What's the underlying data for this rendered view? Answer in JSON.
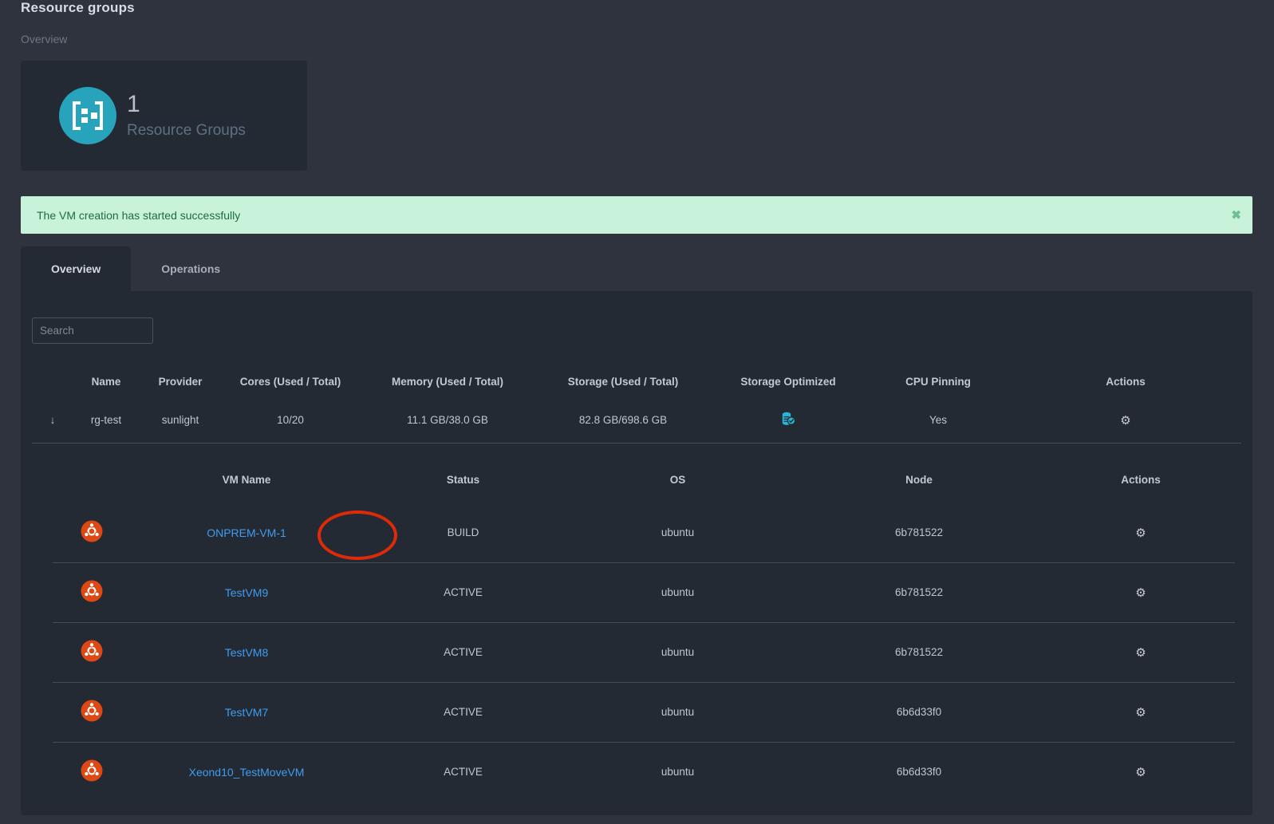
{
  "page": {
    "title": "Resource groups",
    "breadcrumb": "Overview"
  },
  "stat_card": {
    "icon": "resource-group-icon",
    "value": "1",
    "label": "Resource Groups",
    "icon_color": "#27a3bc"
  },
  "alert": {
    "message": "The VM creation has started successfully",
    "close_label": "✖",
    "background": "#c8f2da",
    "text_color": "#1f6b44"
  },
  "tabs": [
    {
      "label": "Overview",
      "active": true
    },
    {
      "label": "Operations",
      "active": false
    }
  ],
  "search": {
    "value": "",
    "placeholder": "Search"
  },
  "resource_group_table": {
    "columns": [
      "",
      "Name",
      "Provider",
      "Cores (Used / Total)",
      "Memory (Used / Total)",
      "Storage (Used / Total)",
      "Storage Optimized",
      "CPU Pinning",
      "Actions"
    ],
    "rows": [
      {
        "expand_icon": "↓",
        "name": "rg-test",
        "provider": "sunlight",
        "cores": "10/20",
        "memory": "11.1 GB/38.0 GB",
        "storage": "82.8 GB/698.6 GB",
        "storage_optimized": "storage-optimized-icon",
        "cpu_pinning": "Yes",
        "actions": "⚙"
      }
    ]
  },
  "vm_table": {
    "columns": [
      "",
      "VM Name",
      "Status",
      "OS",
      "Node",
      "Actions"
    ],
    "rows": [
      {
        "os_icon": "ubuntu-icon",
        "name": "ONPREM-VM-1",
        "status": "BUILD",
        "os": "ubuntu",
        "node": "6b781522",
        "actions": "⚙"
      },
      {
        "os_icon": "ubuntu-icon",
        "name": "TestVM9",
        "status": "ACTIVE",
        "os": "ubuntu",
        "node": "6b781522",
        "actions": "⚙"
      },
      {
        "os_icon": "ubuntu-icon",
        "name": "TestVM8",
        "status": "ACTIVE",
        "os": "ubuntu",
        "node": "6b781522",
        "actions": "⚙"
      },
      {
        "os_icon": "ubuntu-icon",
        "name": "TestVM7",
        "status": "ACTIVE",
        "os": "ubuntu",
        "node": "6b6d33f0",
        "actions": "⚙"
      },
      {
        "os_icon": "ubuntu-icon",
        "name": "Xeond10_TestMoveVM",
        "status": "ACTIVE",
        "os": "ubuntu",
        "node": "6b6d33f0",
        "actions": "⚙"
      }
    ]
  },
  "annotation": {
    "type": "ellipse-highlight",
    "target": "BUILD",
    "color": "#df2a09"
  },
  "colors": {
    "page_background": "#2f333e",
    "panel_background": "#242a33",
    "link": "#3f9cf0",
    "accent": "#27a3bc",
    "ubuntu_orange": "#dd4814"
  }
}
